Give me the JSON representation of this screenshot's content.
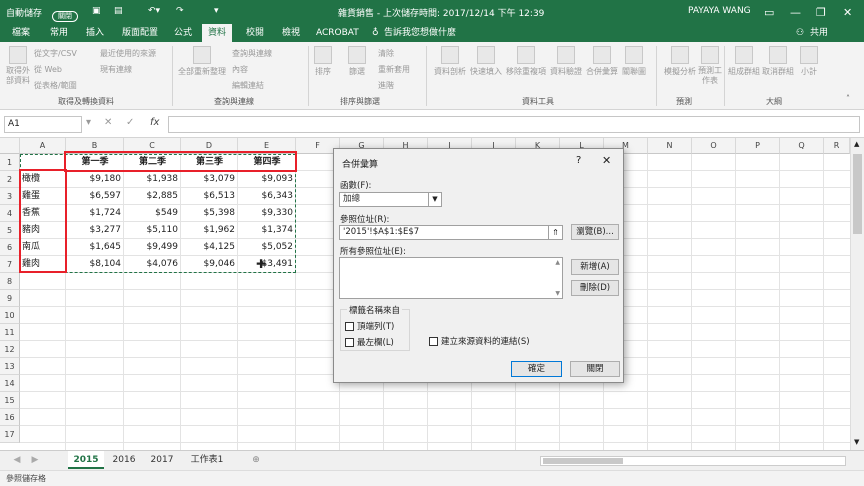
{
  "titlebar": {
    "autosave": "自動儲存",
    "autosave_state": "關閉",
    "title": "雜貨銷售 - 上次儲存時間: 2017/12/14 下午 12:39",
    "user": "PAYAYA WANG"
  },
  "menu": [
    "檔案",
    "常用",
    "插入",
    "版面配置",
    "公式",
    "資料",
    "校閱",
    "檢視",
    "ACROBAT"
  ],
  "menu_active": "資料",
  "tell_me": "告訴我您想做什麼",
  "share": "共用",
  "ribbon": {
    "get_data_label": "取得外部資料",
    "from_text": "從文字/CSV",
    "from_web": "從 Web",
    "from_table": "從表格/範圍",
    "recent_sources": "最近使用的來源",
    "existing_conn": "現有連線",
    "group1": "取得及轉換資料",
    "refresh_all": "全部重新整理",
    "queries_conn": "查詢與連線",
    "properties": "內容",
    "edit_links": "編輯連結",
    "group2": "查詢與連線",
    "sort": "排序",
    "filter": "篩選",
    "clear": "清除",
    "reapply": "重新套用",
    "advanced": "進階",
    "group3": "排序與篩選",
    "text_to_col": "資料剖析",
    "flash_fill": "快速填入",
    "remove_dup": "移除重複項",
    "data_valid": "資料驗證",
    "consolidate": "合併彙算",
    "relationships": "關聯圖",
    "group4": "資料工具",
    "what_if": "模擬分析",
    "forecast": "預測工作表",
    "group5": "預測",
    "group": "組成群組",
    "ungroup": "取消群組",
    "subtotal": "小計",
    "group6": "大綱"
  },
  "formula_bar": {
    "namebox": "A1",
    "fx": "fx"
  },
  "columns": [
    "A",
    "B",
    "C",
    "D",
    "E",
    "F",
    "G",
    "H",
    "I",
    "J",
    "K",
    "L",
    "M",
    "N",
    "O",
    "P",
    "Q",
    "R"
  ],
  "rows": [
    "1",
    "2",
    "3",
    "4",
    "5",
    "6",
    "7",
    "8",
    "9",
    "10",
    "11",
    "12",
    "13",
    "14",
    "15",
    "16",
    "17"
  ],
  "table": {
    "headers": [
      "第一季",
      "第二季",
      "第三季",
      "第四季"
    ],
    "rows": [
      {
        "label": "橄欖",
        "values": [
          "$9,180",
          "$1,938",
          "$3,079",
          "$9,093"
        ]
      },
      {
        "label": "雞蛋",
        "values": [
          "$6,597",
          "$2,885",
          "$6,513",
          "$6,343"
        ]
      },
      {
        "label": "香蕉",
        "values": [
          "$1,724",
          "$549",
          "$5,398",
          "$9,330"
        ]
      },
      {
        "label": "豬肉",
        "values": [
          "$3,277",
          "$5,110",
          "$1,962",
          "$1,374"
        ]
      },
      {
        "label": "南瓜",
        "values": [
          "$1,645",
          "$9,499",
          "$4,125",
          "$5,052"
        ]
      },
      {
        "label": "雞肉",
        "values": [
          "$8,104",
          "$4,076",
          "$9,046",
          "$3,491"
        ]
      }
    ]
  },
  "dialog": {
    "title": "合併彙算",
    "help": "?",
    "close": "✕",
    "function_label": "函數(F):",
    "function_value": "加總",
    "ref_label": "參照位址(R):",
    "ref_value": "'2015'!$A$1:$E$7",
    "browse": "瀏覽(B)...",
    "all_refs_label": "所有參照位址(E):",
    "add": "新增(A)",
    "delete": "刪除(D)",
    "labels_group": "標籤名稱來自",
    "top_row": "頂端列(T)",
    "left_col": "最左欄(L)",
    "create_links": "建立來源資料的連結(S)",
    "ok": "確定",
    "close_btn": "關閉"
  },
  "sheets": [
    "2015",
    "2016",
    "2017",
    "工作表1"
  ],
  "active_sheet": "2015",
  "status": "參照儲存格",
  "colors": {
    "excel_green": "#217346",
    "highlight_red": "#e8202a"
  }
}
